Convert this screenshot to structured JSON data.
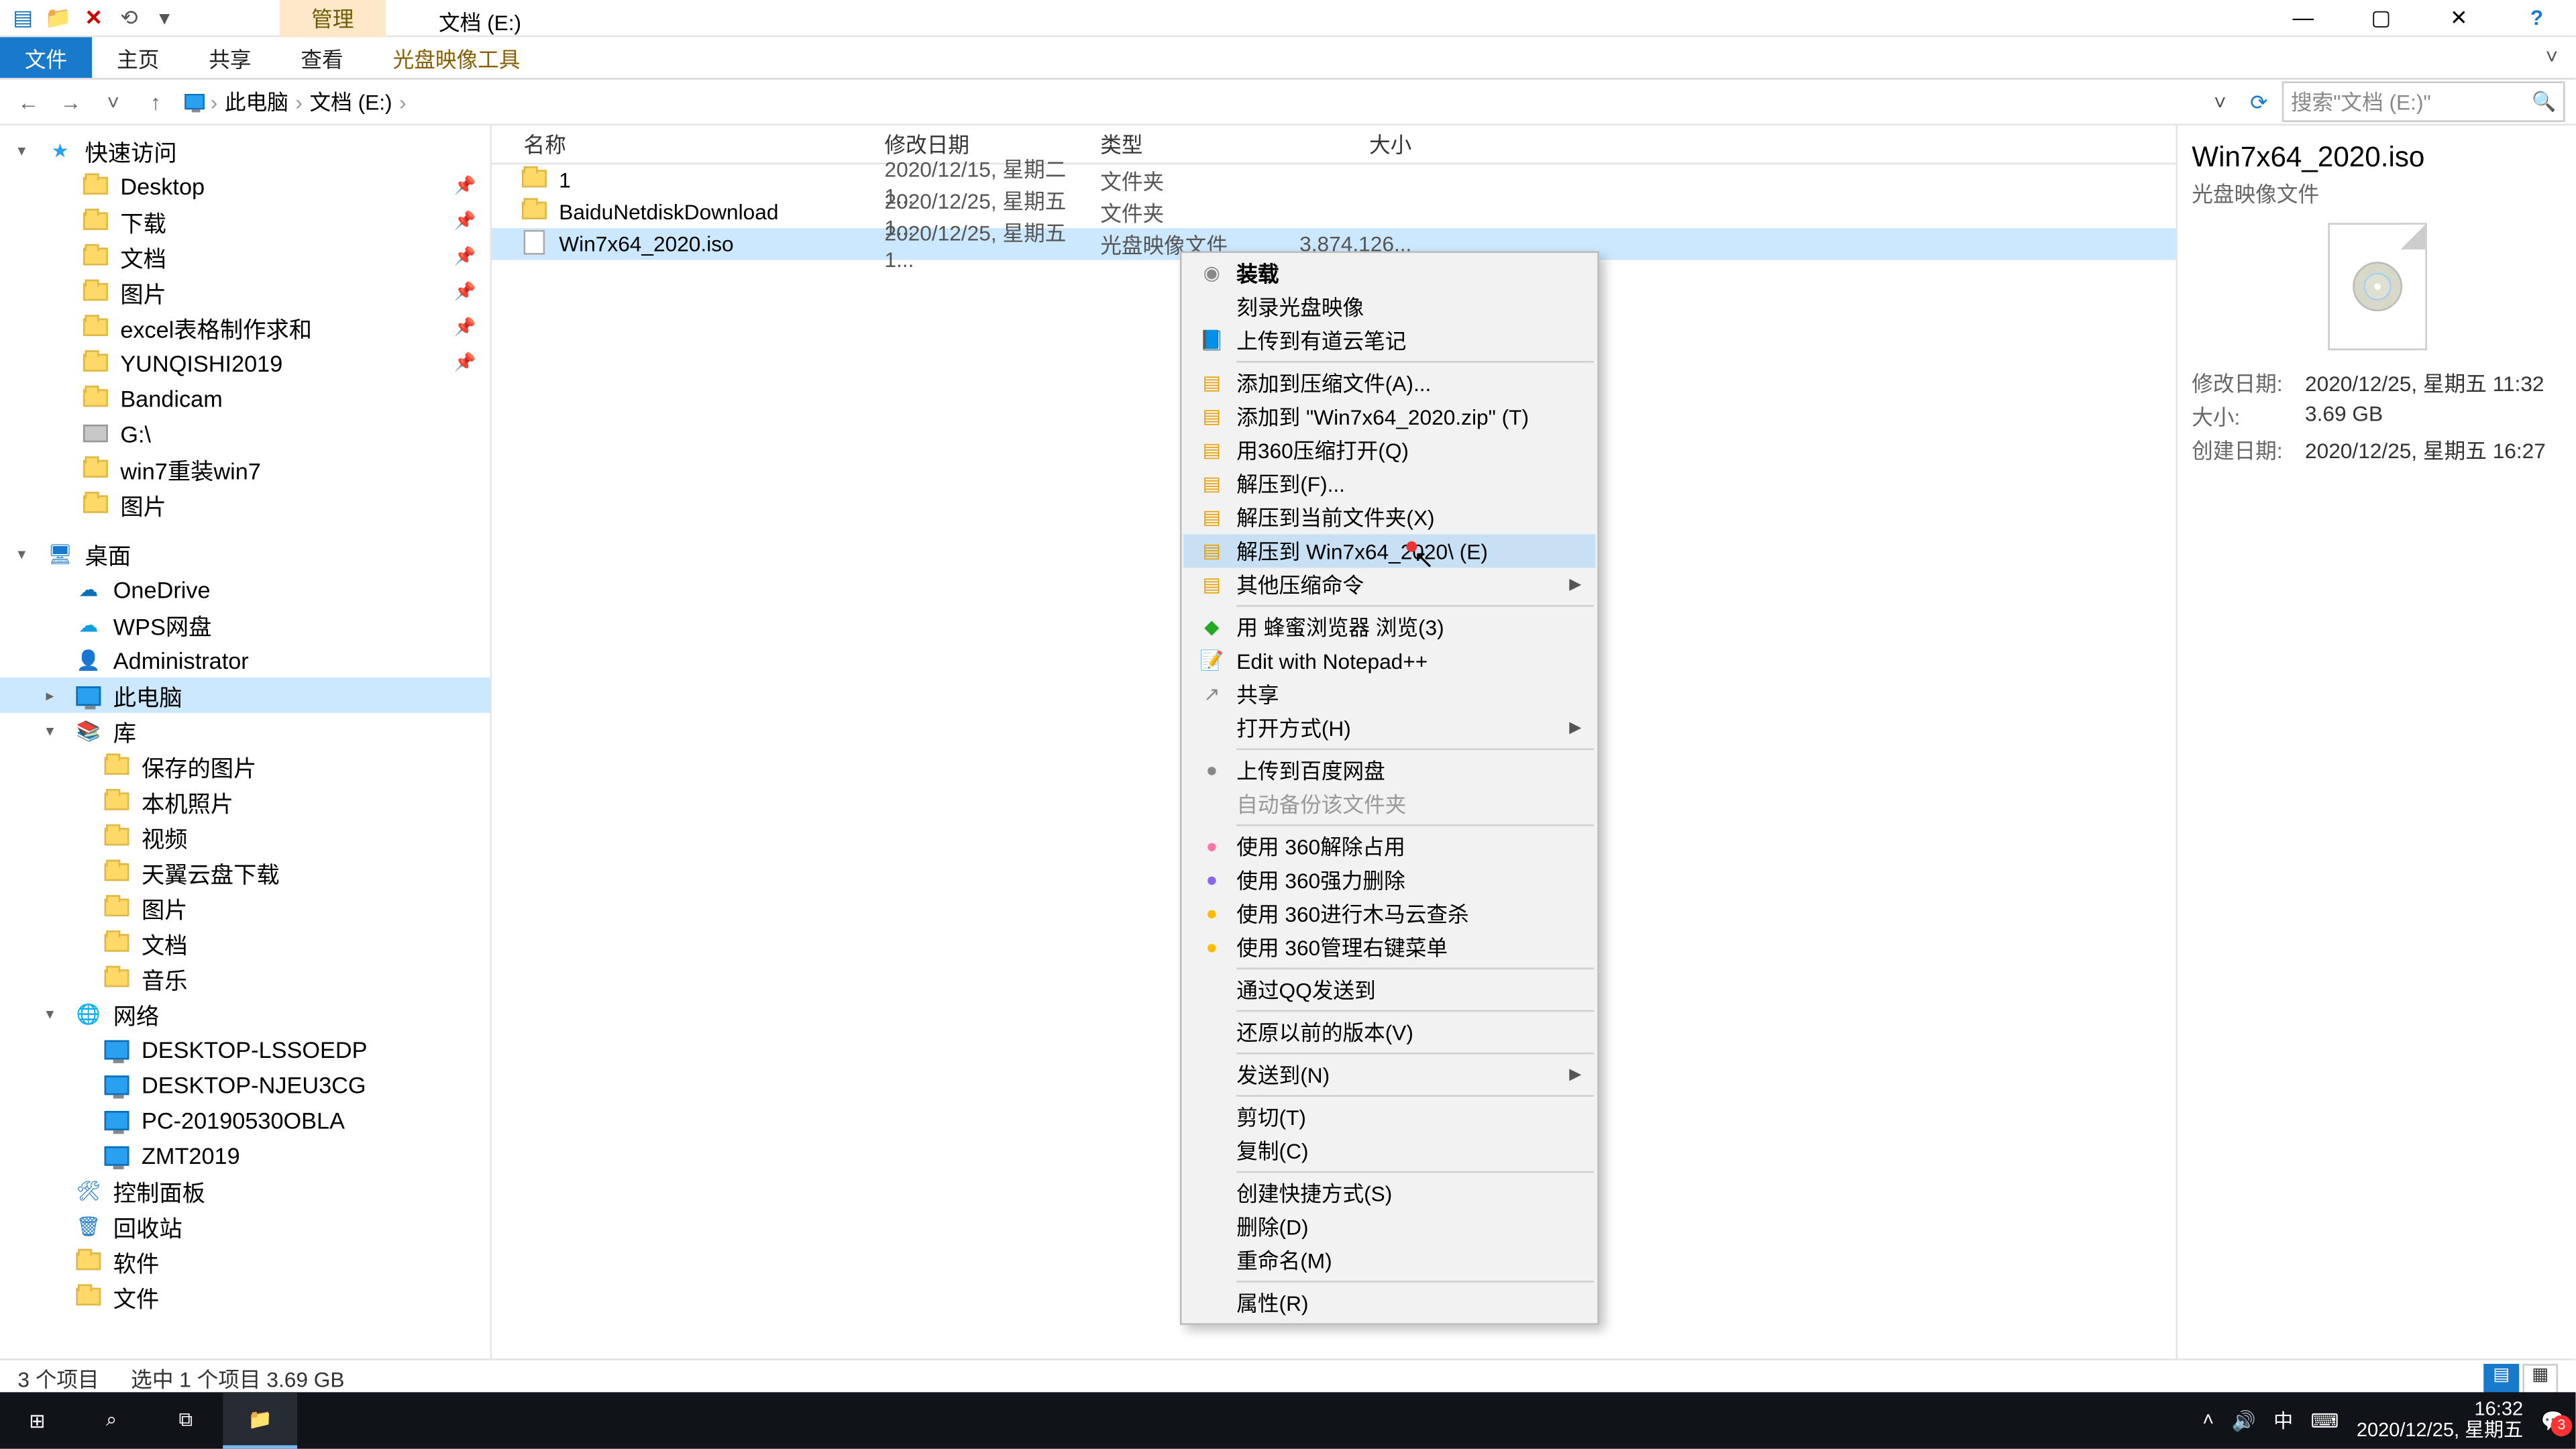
{
  "window": {
    "contextual_tab_title": "管理",
    "title": "文档 (E:)",
    "ribbon": {
      "file": "文件",
      "tabs": [
        "主页",
        "共享",
        "查看"
      ],
      "context_tab": "光盘映像工具"
    },
    "controls": {
      "min": "—",
      "max": "▢",
      "close": "✕",
      "help": "?"
    }
  },
  "nav": {
    "back": "←",
    "fwd": "→",
    "recent": "˅",
    "up": "↑",
    "crumbs": [
      "此电脑",
      "文档 (E:)"
    ],
    "refresh": "⟳",
    "search_placeholder": "搜索\"文档 (E:)\"",
    "search_icon": "🔍"
  },
  "tree": {
    "quick_access": "快速访问",
    "quick_items": [
      {
        "icon": "folder",
        "label": "Desktop",
        "pin": true
      },
      {
        "icon": "folder",
        "label": "下载",
        "pin": true
      },
      {
        "icon": "folder",
        "label": "文档",
        "pin": true
      },
      {
        "icon": "folder",
        "label": "图片",
        "pin": true
      },
      {
        "icon": "folder",
        "label": "excel表格制作求和",
        "pin": true
      },
      {
        "icon": "folder",
        "label": "YUNQISHI2019",
        "pin": true
      },
      {
        "icon": "folder",
        "label": "Bandicam"
      },
      {
        "icon": "drive",
        "label": "G:\\"
      },
      {
        "icon": "folder",
        "label": "win7重装win7"
      },
      {
        "icon": "folder",
        "label": "图片"
      }
    ],
    "desktop_root": "桌面",
    "desktop_items": [
      {
        "icon": "cloud",
        "label": "OneDrive",
        "c": "#0a6fb8"
      },
      {
        "icon": "cloud",
        "label": "WPS网盘",
        "c": "#0aa0e0"
      },
      {
        "icon": "user",
        "label": "Administrator"
      },
      {
        "icon": "monitor",
        "label": "此电脑",
        "selected": true
      },
      {
        "icon": "lib",
        "label": "库"
      },
      {
        "icon": "folder",
        "label": "保存的图片",
        "indent": 1
      },
      {
        "icon": "folder",
        "label": "本机照片",
        "indent": 1
      },
      {
        "icon": "folder",
        "label": "视频",
        "indent": 1
      },
      {
        "icon": "folder",
        "label": "天翼云盘下载",
        "indent": 1
      },
      {
        "icon": "folder",
        "label": "图片",
        "indent": 1
      },
      {
        "icon": "folder",
        "label": "文档",
        "indent": 1
      },
      {
        "icon": "folder",
        "label": "音乐",
        "indent": 1
      },
      {
        "icon": "net",
        "label": "网络"
      },
      {
        "icon": "monitor",
        "label": "DESKTOP-LSSOEDP",
        "indent": 1
      },
      {
        "icon": "monitor",
        "label": "DESKTOP-NJEU3CG",
        "indent": 1
      },
      {
        "icon": "monitor",
        "label": "PC-20190530OBLA",
        "indent": 1
      },
      {
        "icon": "monitor",
        "label": "ZMT2019",
        "indent": 1
      },
      {
        "icon": "panel",
        "label": "控制面板"
      },
      {
        "icon": "bin",
        "label": "回收站"
      },
      {
        "icon": "folder",
        "label": "软件"
      },
      {
        "icon": "folder",
        "label": "文件"
      }
    ]
  },
  "columns": {
    "name": "名称",
    "date": "修改日期",
    "type": "类型",
    "size": "大小"
  },
  "rows": [
    {
      "icon": "folder",
      "name": "1",
      "date": "2020/12/15, 星期二 1...",
      "type": "文件夹",
      "size": ""
    },
    {
      "icon": "folder",
      "name": "BaiduNetdiskDownload",
      "date": "2020/12/25, 星期五 1...",
      "type": "文件夹",
      "size": ""
    },
    {
      "icon": "disc",
      "name": "Win7x64_2020.iso",
      "date": "2020/12/25, 星期五 1...",
      "type": "光盘映像文件",
      "size": "3,874,126...",
      "selected": true
    }
  ],
  "details": {
    "title": "Win7x64_2020.iso",
    "subtitle": "光盘映像文件",
    "props": [
      {
        "k": "修改日期:",
        "v": "2020/12/25, 星期五 11:32"
      },
      {
        "k": "大小:",
        "v": "3.69 GB"
      },
      {
        "k": "创建日期:",
        "v": "2020/12/25, 星期五 16:27"
      }
    ]
  },
  "status": {
    "count": "3 个项目",
    "sel": "选中 1 个项目  3.69 GB"
  },
  "context_menu": [
    [
      {
        "icon": "disc",
        "label": "装载",
        "bold": true
      },
      {
        "icon": "",
        "label": "刻录光盘映像"
      },
      {
        "icon": "note",
        "label": "上传到有道云笔记",
        "c": "#1979ca"
      }
    ],
    [
      {
        "icon": "zip",
        "label": "添加到压缩文件(A)..."
      },
      {
        "icon": "zip",
        "label": "添加到 \"Win7x64_2020.zip\" (T)"
      },
      {
        "icon": "zip",
        "label": "用360压缩打开(Q)"
      },
      {
        "icon": "zip",
        "label": "解压到(F)..."
      },
      {
        "icon": "zip",
        "label": "解压到当前文件夹(X)"
      },
      {
        "icon": "zip",
        "label": "解压到 Win7x64_2020\\ (E)",
        "hover": true
      },
      {
        "icon": "zip",
        "label": "其他压缩命令",
        "sub": true
      }
    ],
    [
      {
        "icon": "brw",
        "label": "用 蜂蜜浏览器 浏览(3)",
        "c": "#2a2"
      },
      {
        "icon": "npp",
        "label": "Edit with Notepad++",
        "c": "#7c3"
      },
      {
        "icon": "share",
        "label": "共享"
      },
      {
        "icon": "",
        "label": "打开方式(H)",
        "sub": true
      }
    ],
    [
      {
        "icon": "bd",
        "label": "上传到百度网盘"
      },
      {
        "icon": "",
        "label": "自动备份该文件夹",
        "disabled": true
      }
    ],
    [
      {
        "icon": "360",
        "label": "使用 360解除占用",
        "c": "#f7a"
      },
      {
        "icon": "360",
        "label": "使用 360强力删除",
        "c": "#86e"
      },
      {
        "icon": "360",
        "label": "使用 360进行木马云查杀",
        "c": "#fb0"
      },
      {
        "icon": "360",
        "label": "使用 360管理右键菜单",
        "c": "#fb0"
      }
    ],
    [
      {
        "icon": "",
        "label": "通过QQ发送到"
      }
    ],
    [
      {
        "icon": "",
        "label": "还原以前的版本(V)"
      }
    ],
    [
      {
        "icon": "",
        "label": "发送到(N)",
        "sub": true
      }
    ],
    [
      {
        "icon": "",
        "label": "剪切(T)"
      },
      {
        "icon": "",
        "label": "复制(C)"
      }
    ],
    [
      {
        "icon": "",
        "label": "创建快捷方式(S)"
      },
      {
        "icon": "",
        "label": "删除(D)"
      },
      {
        "icon": "",
        "label": "重命名(M)"
      }
    ],
    [
      {
        "icon": "",
        "label": "属性(R)"
      }
    ]
  ],
  "taskbar": {
    "time": "16:32",
    "date": "2020/12/25, 星期五",
    "ime": "中",
    "badge": "3"
  }
}
